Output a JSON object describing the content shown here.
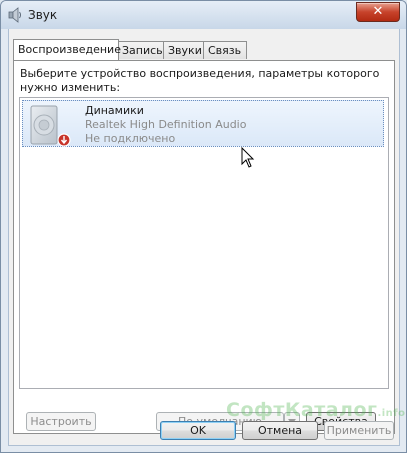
{
  "window": {
    "title": "Звук",
    "close_glyph": "✕"
  },
  "tabs": [
    {
      "label": "Воспроизведение",
      "active": true
    },
    {
      "label": "Запись",
      "active": false
    },
    {
      "label": "Звуки",
      "active": false
    },
    {
      "label": "Связь",
      "active": false
    }
  ],
  "playback": {
    "instruction": "Выберите устройство воспроизведения, параметры которого нужно изменить:",
    "devices": [
      {
        "name": "Динамики",
        "driver": "Realtek High Definition Audio",
        "status": "Не подключено",
        "icon": "speaker-icon",
        "badge_icon": "unplugged-badge-icon"
      }
    ],
    "buttons": {
      "configure": "Настроить",
      "set_default": "По умолчанию",
      "properties": "Свойства"
    }
  },
  "dialog_buttons": {
    "ok": "OK",
    "cancel": "Отмена",
    "apply": "Применить"
  },
  "watermark": {
    "main": "СофтКаталог",
    "suffix": ".info"
  },
  "colors": {
    "accent": "#3c7fb1",
    "selection": "#dbe8f8",
    "badge": "#c8342a"
  }
}
